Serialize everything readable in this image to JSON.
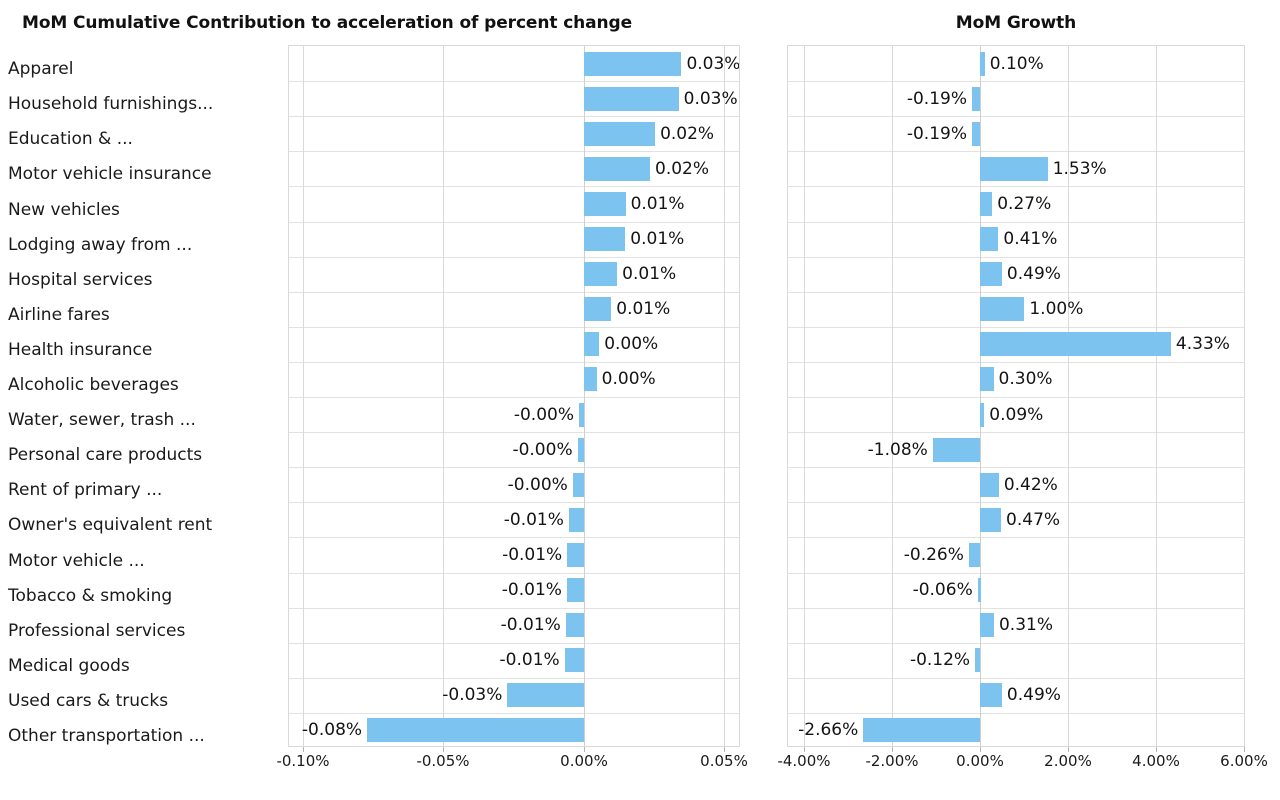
{
  "chart_data": [
    {
      "type": "bar",
      "orientation": "horizontal",
      "title": "MoM Cumulative Contribution to acceleration of percent change",
      "xlabel": "",
      "ylabel": "",
      "xlim": [
        -0.105,
        0.0553
      ],
      "xticks": [
        -0.1,
        -0.05,
        0.0,
        0.05
      ],
      "xtick_labels": [
        "-0.10%",
        "-0.05%",
        "0.00%",
        "0.05%"
      ],
      "grid": true,
      "legend": "none",
      "bar_color": "#7cc3f0",
      "categories": [
        "Apparel",
        "Household furnishings...",
        "Education & ...",
        "Motor vehicle insurance",
        "New vehicles",
        "Lodging away from ...",
        "Hospital services",
        "Airline fares",
        "Health insurance",
        "Alcoholic beverages",
        "Water, sewer, trash ...",
        "Personal care products",
        "Rent of primary ...",
        "Owner's equivalent rent",
        "Motor vehicle ...",
        "Tobacco & smoking",
        "Professional services",
        "Medical goods",
        "Used cars & trucks",
        "Other transportation ..."
      ],
      "values": [
        0.0348,
        0.0338,
        0.0254,
        0.0236,
        0.0149,
        0.0148,
        0.0119,
        0.0098,
        0.0055,
        0.0046,
        -0.0017,
        -0.0022,
        -0.0039,
        -0.0053,
        -0.0059,
        -0.006,
        -0.0064,
        -0.0068,
        -0.0272,
        -0.0772
      ],
      "data_labels": [
        "0.03%",
        "0.03%",
        "0.02%",
        "0.02%",
        "0.01%",
        "0.01%",
        "0.01%",
        "0.01%",
        "0.00%",
        "0.00%",
        "-0.00%",
        "-0.00%",
        "-0.00%",
        "-0.01%",
        "-0.01%",
        "-0.01%",
        "-0.01%",
        "-0.01%",
        "-0.03%",
        "-0.08%"
      ]
    },
    {
      "type": "bar",
      "orientation": "horizontal",
      "title": "MoM Growth",
      "xlabel": "",
      "ylabel": "",
      "xlim": [
        -4.37,
        5.99
      ],
      "xticks": [
        -4.0,
        -2.0,
        0.0,
        2.0,
        4.0,
        6.0
      ],
      "xtick_labels": [
        "-4.00%",
        "-2.00%",
        "0.00%",
        "2.00%",
        "4.00%",
        "6.00%"
      ],
      "grid": true,
      "legend": "none",
      "bar_color": "#7cc3f0",
      "categories": [
        "Apparel",
        "Household furnishings...",
        "Education & ...",
        "Motor vehicle insurance",
        "New vehicles",
        "Lodging away from ...",
        "Hospital services",
        "Airline fares",
        "Health insurance",
        "Alcoholic beverages",
        "Water, sewer, trash ...",
        "Personal care products",
        "Rent of primary ...",
        "Owner's equivalent rent",
        "Motor vehicle ...",
        "Tobacco & smoking",
        "Professional services",
        "Medical goods",
        "Used cars & trucks",
        "Other transportation ..."
      ],
      "values": [
        0.1,
        -0.19,
        -0.19,
        1.53,
        0.27,
        0.41,
        0.49,
        1.0,
        4.33,
        0.3,
        0.09,
        -1.08,
        0.42,
        0.47,
        -0.26,
        -0.06,
        0.31,
        -0.12,
        0.49,
        -2.66
      ],
      "data_labels": [
        "0.10%",
        "-0.19%",
        "-0.19%",
        "1.53%",
        "0.27%",
        "0.41%",
        "0.49%",
        "1.00%",
        "4.33%",
        "0.30%",
        "0.09%",
        "-1.08%",
        "0.42%",
        "0.47%",
        "-0.26%",
        "-0.06%",
        "0.31%",
        "-0.12%",
        "0.49%",
        "-2.66%"
      ]
    }
  ]
}
